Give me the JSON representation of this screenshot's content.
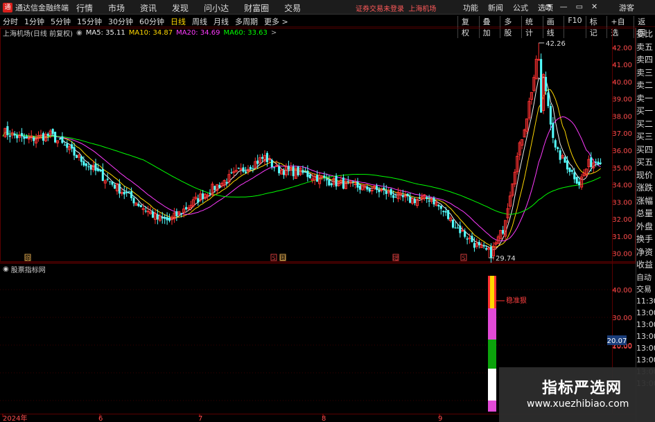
{
  "titlebar": {
    "app_name": "通达信金融终端",
    "menu": [
      "行情",
      "市场",
      "资讯",
      "发现",
      "问小达",
      "财富圈",
      "交易"
    ],
    "notice": "证券交易未登录",
    "market": "上海机场",
    "right_menu": [
      "功能",
      "新闻",
      "公式",
      "选项"
    ],
    "guest": "游客"
  },
  "period_bar": {
    "items": [
      "分时",
      "1分钟",
      "5分钟",
      "15分钟",
      "30分钟",
      "60分钟",
      "日线",
      "周线",
      "月线",
      "多周期",
      "更多 >"
    ],
    "active": "日线",
    "right": [
      "复权",
      "叠加",
      "多股",
      "统计",
      "画线",
      "F10",
      "标记",
      "+自选",
      "返回"
    ]
  },
  "main_chart": {
    "stock": "上海机场(日线 前复权)",
    "ma": [
      {
        "label": "MA5: 35.11",
        "color": "#f0f0f0"
      },
      {
        "label": "MA10: 34.87",
        "color": "#ffd700"
      },
      {
        "label": "MA20: 34.69",
        "color": "#ff3bff"
      },
      {
        "label": "MA60: 33.63",
        "color": "#00ff00"
      }
    ],
    "yticks": [
      "42.00",
      "41.00",
      "40.00",
      "39.00",
      "38.00",
      "37.00",
      "36.00",
      "35.00",
      "34.00",
      "33.00",
      "32.00",
      "31.00",
      "30.00"
    ],
    "high_label": "42.26",
    "low_label": "29.74"
  },
  "indicator": {
    "title": "股票指标网",
    "yticks": [
      "40.00",
      "30.00",
      "20.00",
      "10.00"
    ],
    "current": "20.07",
    "annotation": "稳准狠"
  },
  "x_labels": [
    "2024年",
    "6",
    "7",
    "8",
    "9"
  ],
  "markers": [
    "资",
    "S",
    "图",
    "增",
    "S"
  ],
  "right_panel": {
    "quote": [
      "委比",
      "卖五",
      "卖四",
      "卖三",
      "卖二",
      "卖一",
      "买一",
      "买二",
      "买三",
      "买四",
      "买五",
      "现价",
      "涨跌",
      "涨幅",
      "总量",
      "外盘",
      "换手",
      "净资",
      "收益"
    ],
    "trades": [
      "自动",
      "交易",
      "11:30",
      "13:00",
      "13:00",
      "13:00",
      "13:00",
      "13:00",
      "13:00",
      "13:00"
    ]
  },
  "watermark": {
    "cn": "指标严选网",
    "url": "www.xuezhibiao.com"
  },
  "chart_data": {
    "type": "candlestick",
    "x": [
      "2024年",
      "6",
      "7",
      "8",
      "9"
    ],
    "ylim": [
      29.5,
      42.5
    ],
    "high": 42.26,
    "low": 29.74,
    "ma_last": {
      "MA5": 35.11,
      "MA10": 34.87,
      "MA20": 34.69,
      "MA60": 33.63
    }
  },
  "colors": {
    "up": "#ff3232",
    "down": "#54ffff",
    "ma5": "#f0f0f0",
    "ma10": "#ffd700",
    "ma20": "#ff3bff",
    "ma60": "#00ff00",
    "grid": "#5a0000"
  }
}
